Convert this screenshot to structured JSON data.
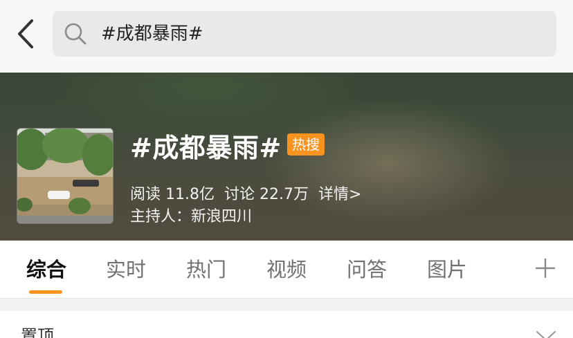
{
  "search": {
    "query": "#成都暴雨#"
  },
  "topic": {
    "title": "#成都暴雨#",
    "badge": "热搜",
    "reads": "阅读 11.8亿",
    "discussions": "讨论 22.7万",
    "details_link": "详情>",
    "host": "主持人：新浪四川"
  },
  "tabs": [
    {
      "label": "综合",
      "active": true
    },
    {
      "label": "实时",
      "active": false
    },
    {
      "label": "热门",
      "active": false
    },
    {
      "label": "视频",
      "active": false
    },
    {
      "label": "问答",
      "active": false
    },
    {
      "label": "图片",
      "active": false
    }
  ],
  "pinned": {
    "label": "置顶"
  },
  "colors": {
    "accent": "#f7931e",
    "search_bg": "#e9e9ea"
  },
  "icons": [
    "back-arrow-icon",
    "search-icon",
    "plus-icon",
    "chevron-down-icon"
  ]
}
